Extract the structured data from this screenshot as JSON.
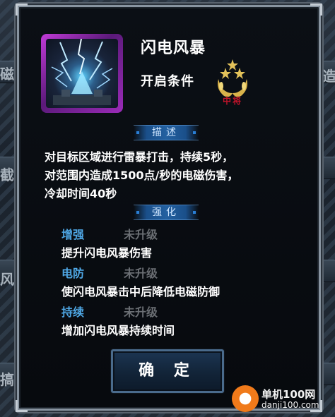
{
  "skill": {
    "name": "闪电风暴",
    "unlock_label": "开启条件",
    "rank_text": "中将"
  },
  "sections": {
    "description_title": "描述",
    "upgrade_title": "强化"
  },
  "description_lines": [
    "对目标区域进行雷暴打击，持续5秒，",
    "对范围内造成1500点/秒的电磁伤害，",
    "冷却时间40秒"
  ],
  "upgrades": [
    {
      "name": "增强",
      "status": "未升级",
      "desc": "提升闪电风暴伤害"
    },
    {
      "name": "电防",
      "status": "未升级",
      "desc": "使闪电风暴击中后降低电磁防御"
    },
    {
      "name": "持续",
      "status": "未升级",
      "desc": "增加闪电风暴持续时间"
    }
  ],
  "confirm_label": "确 定",
  "background_glyphs": [
    "磁",
    "截",
    "风",
    "搞",
    "造"
  ],
  "watermark": {
    "site": "单机100网",
    "url": "danji100.com"
  },
  "colors": {
    "upgrade_name": "#4fa8e6",
    "status_gray": "#6b6f74",
    "rank_red": "#c0132a",
    "gold": "#d8b24a"
  }
}
